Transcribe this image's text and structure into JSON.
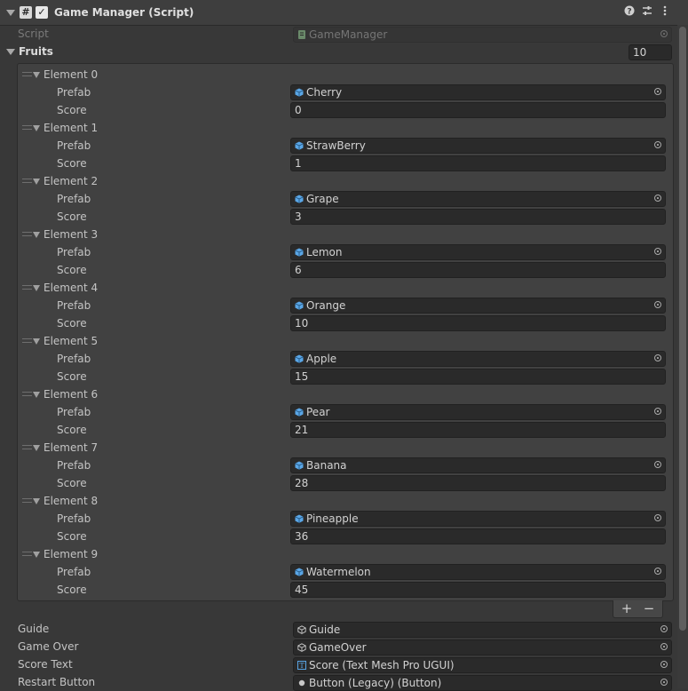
{
  "component": {
    "title": "Game Manager (Script)",
    "icon": "hash-script-icon",
    "enabled_check": "✓",
    "header_icons": [
      "help-icon",
      "preset-sliders-icon",
      "more-vertical-icon"
    ]
  },
  "script": {
    "label": "Script",
    "value": "GameManager"
  },
  "fruits": {
    "label": "Fruits",
    "size": "10",
    "prefab_label": "Prefab",
    "score_label": "Score",
    "elements": [
      {
        "label": "Element 0",
        "prefab": "Cherry",
        "score": "0"
      },
      {
        "label": "Element 1",
        "prefab": "StrawBerry",
        "score": "1"
      },
      {
        "label": "Element 2",
        "prefab": "Grape",
        "score": "3"
      },
      {
        "label": "Element 3",
        "prefab": "Lemon",
        "score": "6"
      },
      {
        "label": "Element 4",
        "prefab": "Orange",
        "score": "10"
      },
      {
        "label": "Element 5",
        "prefab": "Apple",
        "score": "15"
      },
      {
        "label": "Element 6",
        "prefab": "Pear",
        "score": "21"
      },
      {
        "label": "Element 7",
        "prefab": "Banana",
        "score": "28"
      },
      {
        "label": "Element 8",
        "prefab": "Pineapple",
        "score": "36"
      },
      {
        "label": "Element 9",
        "prefab": "Watermelon",
        "score": "45"
      }
    ],
    "add_label": "+",
    "remove_label": "−"
  },
  "fields": [
    {
      "label": "Guide",
      "value": "Guide",
      "icon": "gameobject-icon"
    },
    {
      "label": "Game Over",
      "value": "GameOver",
      "icon": "gameobject-icon"
    },
    {
      "label": "Score Text",
      "value": "Score (Text Mesh Pro UGUI)",
      "icon": "text-mesh-pro-icon"
    },
    {
      "label": "Restart Button",
      "value": "Button (Legacy) (Button)",
      "icon": "button-icon"
    }
  ],
  "colors": {
    "background": "#383838",
    "field": "#2a2a2a",
    "prefab_icon": "#5aa6e6"
  }
}
